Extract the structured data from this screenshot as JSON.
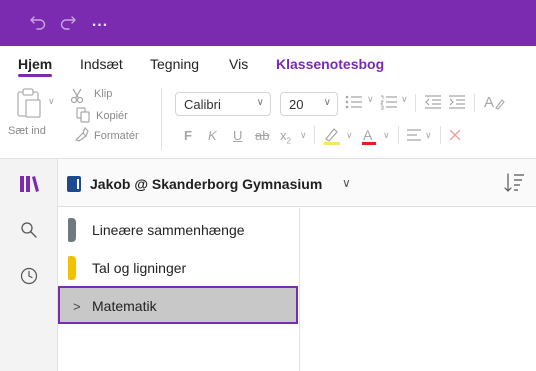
{
  "titlebar": {
    "undo_icon": "undo-icon",
    "redo_icon": "redo-icon",
    "more_label": "...",
    "color": "#7a2bb0"
  },
  "tabs": [
    {
      "label": "Hjem",
      "active": true
    },
    {
      "label": "Indsæt"
    },
    {
      "label": "Tegning"
    },
    {
      "label": "Vis"
    },
    {
      "label": "Klassenotesbog",
      "accent": true
    }
  ],
  "ribbon": {
    "paste_label": "Sæt ind",
    "cut_label": "Klip",
    "copy_label": "Kopiér",
    "format_label": "Formatér",
    "font_name": "Calibri",
    "font_size": "20",
    "bold_label": "F",
    "italic_label": "K",
    "underline_label": "U",
    "strike_label": "ab",
    "subscript_label": "x",
    "sub_mark": "2",
    "highlight_color": "#f5e663",
    "font_color": "#e02020"
  },
  "rail": {
    "items": [
      "notebooks-icon",
      "search-icon",
      "recent-icon"
    ],
    "accent": "#7a2bb0"
  },
  "notebook": {
    "title": "Jakob @ Skanderborg Gymnasium",
    "chevron": "∨",
    "icon_color": "#1e4b8e"
  },
  "sections": [
    {
      "label": "Lineære sammenhænge",
      "color": "#6f7a80",
      "type": "section"
    },
    {
      "label": "Tal og ligninger",
      "color": "#f2c200",
      "type": "section"
    },
    {
      "label": "Matematik",
      "type": "group",
      "selected": true
    }
  ]
}
